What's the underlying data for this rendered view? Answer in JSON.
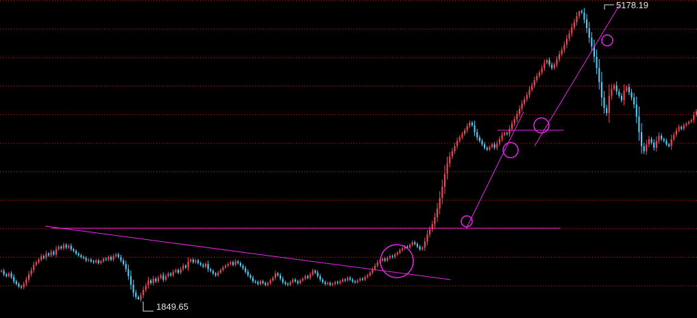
{
  "chart_data": {
    "type": "candlestick",
    "title": "",
    "xlabel": "",
    "ylabel": "",
    "ylim": [
      1700,
      5250
    ],
    "grid": true,
    "grid_style": "dotted-horizontal",
    "annotations": {
      "high_label": "5178.19",
      "low_label": "1849.65",
      "high_value": 5178.19,
      "low_value": 1849.65
    },
    "overlay_markings": {
      "trendlines": 5,
      "circles": 6
    },
    "series": [
      {
        "values": [
          2180,
          2140,
          2120,
          2150,
          2110,
          2060,
          2030,
          2000,
          1990,
          2030,
          2080,
          2140,
          2190,
          2250,
          2280,
          2310,
          2350,
          2330,
          2380,
          2360,
          2400,
          2370,
          2430,
          2460,
          2440,
          2480,
          2450,
          2470,
          2430,
          2410,
          2380,
          2360,
          2340,
          2330,
          2300,
          2310,
          2290,
          2280,
          2300,
          2270,
          2290,
          2320,
          2310,
          2340,
          2310,
          2350,
          2370,
          2340,
          2300,
          2260,
          2200,
          2120,
          2020,
          1930,
          1880,
          1850,
          1900,
          1960,
          2010,
          2070,
          2040,
          2090,
          2060,
          2100,
          2130,
          2080,
          2120,
          2150,
          2130,
          2170,
          2190,
          2160,
          2200,
          2240,
          2220,
          2290,
          2310,
          2280,
          2300,
          2270,
          2250,
          2230,
          2260,
          2200,
          2180,
          2150,
          2130,
          2160,
          2190,
          2220,
          2240,
          2260,
          2280,
          2250,
          2290,
          2270,
          2240,
          2210,
          2170,
          2130,
          2100,
          2060,
          2050,
          2030,
          2060,
          2040,
          2020,
          2040,
          2070,
          2100,
          2150,
          2130,
          2090,
          2050,
          2030,
          2020,
          2050,
          2080,
          2060,
          2040,
          2070,
          2090,
          2120,
          2100,
          2140,
          2180,
          2160,
          2120,
          2080,
          2050,
          2030,
          2040,
          2020,
          2030,
          2050,
          2040,
          2060,
          2080,
          2070,
          2100,
          2080,
          2060,
          2050,
          2070,
          2090,
          2080,
          2110,
          2130,
          2160,
          2200,
          2240,
          2280,
          2300,
          2320,
          2300,
          2330,
          2350,
          2340,
          2370,
          2390,
          2420,
          2440,
          2460,
          2450,
          2480,
          2510,
          2490,
          2460,
          2430,
          2450,
          2520,
          2600,
          2660,
          2720,
          2800,
          2900,
          3020,
          3150,
          3300,
          3420,
          3500,
          3560,
          3620,
          3680,
          3720,
          3760,
          3800,
          3850,
          3890,
          3860,
          3780,
          3720,
          3680,
          3640,
          3600,
          3580,
          3610,
          3640,
          3600,
          3650,
          3700,
          3750,
          3770,
          3760,
          3820,
          3880,
          3930,
          3990,
          4050,
          4110,
          4160,
          4210,
          4270,
          4320,
          4380,
          4430,
          4470,
          4520,
          4580,
          4610,
          4560,
          4520,
          4560,
          4620,
          4680,
          4730,
          4790,
          4860,
          4920,
          4990,
          5050,
          5120,
          5178,
          5160,
          5080,
          4980,
          4870,
          4770,
          4650,
          4520,
          4360,
          4180,
          4060,
          4000,
          4200,
          4280,
          4320,
          4250,
          4200,
          4150,
          4260,
          4300,
          4240,
          4180,
          4100,
          3960,
          3780,
          3620,
          3560,
          3640,
          3700,
          3660,
          3600,
          3680,
          3740,
          3700,
          3680,
          3640,
          3620,
          3700,
          3750,
          3800,
          3840,
          3820,
          3860,
          3880,
          3900,
          3920,
          3980,
          4020
        ]
      }
    ]
  },
  "colors": {
    "background": "#000000",
    "grid": "#b31b1b",
    "up_candle": "#f24a5a",
    "down_candle": "#4fd2ff",
    "overlay": "#ee26ee",
    "label_text": "#e6e6e6"
  }
}
